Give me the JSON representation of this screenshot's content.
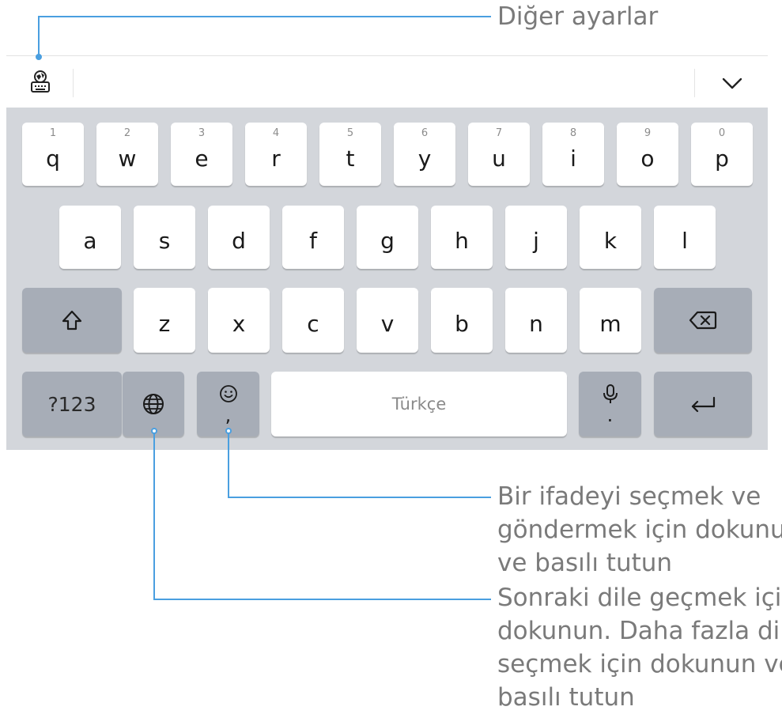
{
  "callouts": {
    "settings": "Diğer ayarlar",
    "emoji": [
      "Bir ifadeyi seçmek ve",
      "göndermek için dokunun",
      "ve basılı tutun"
    ],
    "language": [
      "Sonraki dile geçmek için",
      "dokunun. Daha fazla dil",
      "seçmek için dokunun ve",
      "basılı tutun"
    ]
  },
  "toolbar": {
    "settings_icon": "keyboard-settings-icon",
    "collapse_icon": "chevron-down-icon"
  },
  "keyboard": {
    "row1": [
      {
        "ch": "q",
        "num": "1"
      },
      {
        "ch": "w",
        "num": "2"
      },
      {
        "ch": "e",
        "num": "3"
      },
      {
        "ch": "r",
        "num": "4"
      },
      {
        "ch": "t",
        "num": "5"
      },
      {
        "ch": "y",
        "num": "6"
      },
      {
        "ch": "u",
        "num": "7"
      },
      {
        "ch": "i",
        "num": "8"
      },
      {
        "ch": "o",
        "num": "9"
      },
      {
        "ch": "p",
        "num": "0"
      }
    ],
    "row2": [
      "a",
      "s",
      "d",
      "f",
      "g",
      "h",
      "j",
      "k",
      "l"
    ],
    "row3": [
      "z",
      "x",
      "c",
      "v",
      "b",
      "n",
      "m"
    ],
    "row4": {
      "numbers_label": "?123",
      "emoji_sub": ",",
      "space_label": "Türkçe",
      "mic_sub": "."
    }
  },
  "colors": {
    "accent": "#4a9fe0",
    "function_key": "#a7adb7",
    "keyboard_bg": "#d3d6db"
  }
}
